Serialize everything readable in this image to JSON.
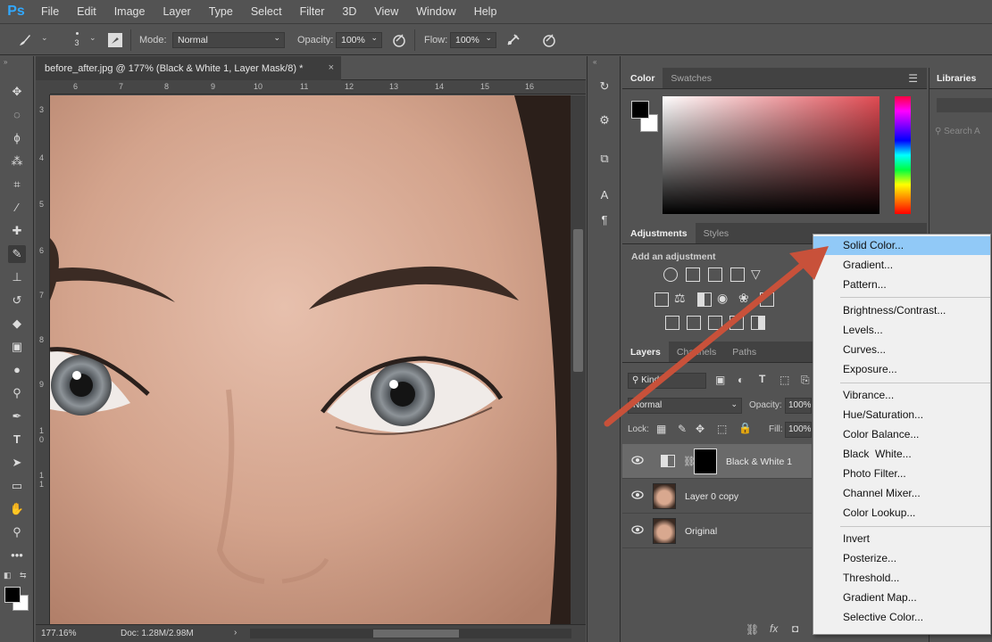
{
  "app": {
    "logo": "Ps"
  },
  "menubar": {
    "items": [
      "File",
      "Edit",
      "Image",
      "Layer",
      "Type",
      "Select",
      "Filter",
      "3D",
      "View",
      "Window",
      "Help"
    ]
  },
  "options": {
    "brush_size": "3",
    "mode_label": "Mode:",
    "mode_value": "Normal",
    "opacity_label": "Opacity:",
    "opacity_value": "100%",
    "flow_label": "Flow:",
    "flow_value": "100%"
  },
  "document": {
    "tab_title": "before_after.jpg @ 177% (Black & White 1, Layer Mask/8) *",
    "close_glyph": "×",
    "ruler_top": [
      "6",
      "7",
      "8",
      "9",
      "10",
      "11",
      "12",
      "13",
      "14",
      "15",
      "16"
    ],
    "ruler_left": [
      "3",
      "4",
      "5",
      "6",
      "7",
      "8",
      "9",
      "1",
      "0",
      "1",
      "1"
    ],
    "zoom": "177.16%",
    "doc_size": "Doc: 1.28M/2.98M"
  },
  "color_panel": {
    "tabs": [
      "Color",
      "Swatches"
    ]
  },
  "adjustments_panel": {
    "tabs": [
      "Adjustments",
      "Styles"
    ],
    "hint": "Add an adjustment"
  },
  "layers_panel": {
    "tabs": [
      "Layers",
      "Channels",
      "Paths"
    ],
    "filter_value": "Kind",
    "blend_mode": "Normal",
    "opacity_label": "Opacity:",
    "opacity_value": "100%",
    "lock_label": "Lock:",
    "fill_label": "Fill:",
    "fill_value": "100%",
    "layers": [
      {
        "name": "Black & White 1",
        "selected": true
      },
      {
        "name": "Layer 0 copy",
        "selected": false
      },
      {
        "name": "Original",
        "selected": false
      }
    ],
    "fx_label": "fx"
  },
  "libraries_panel": {
    "title": "Libraries",
    "search_placeholder": "Search A"
  },
  "dropdown": {
    "groups": [
      [
        "Solid Color...",
        "Gradient...",
        "Pattern..."
      ],
      [
        "Brightness/Contrast...",
        "Levels...",
        "Curves...",
        "Exposure..."
      ],
      [
        "Vibrance...",
        "Hue/Saturation...",
        "Color Balance...",
        "Black  White...",
        "Photo Filter...",
        "Channel Mixer...",
        "Color Lookup..."
      ],
      [
        "Invert",
        "Posterize...",
        "Threshold...",
        "Gradient Map...",
        "Selective Color..."
      ]
    ],
    "highlighted": "Solid Color..."
  },
  "colors": {
    "accent_arrow": "#c8513a",
    "menu_highlight": "#91c9f7",
    "ps_blue": "#31a8ff"
  }
}
